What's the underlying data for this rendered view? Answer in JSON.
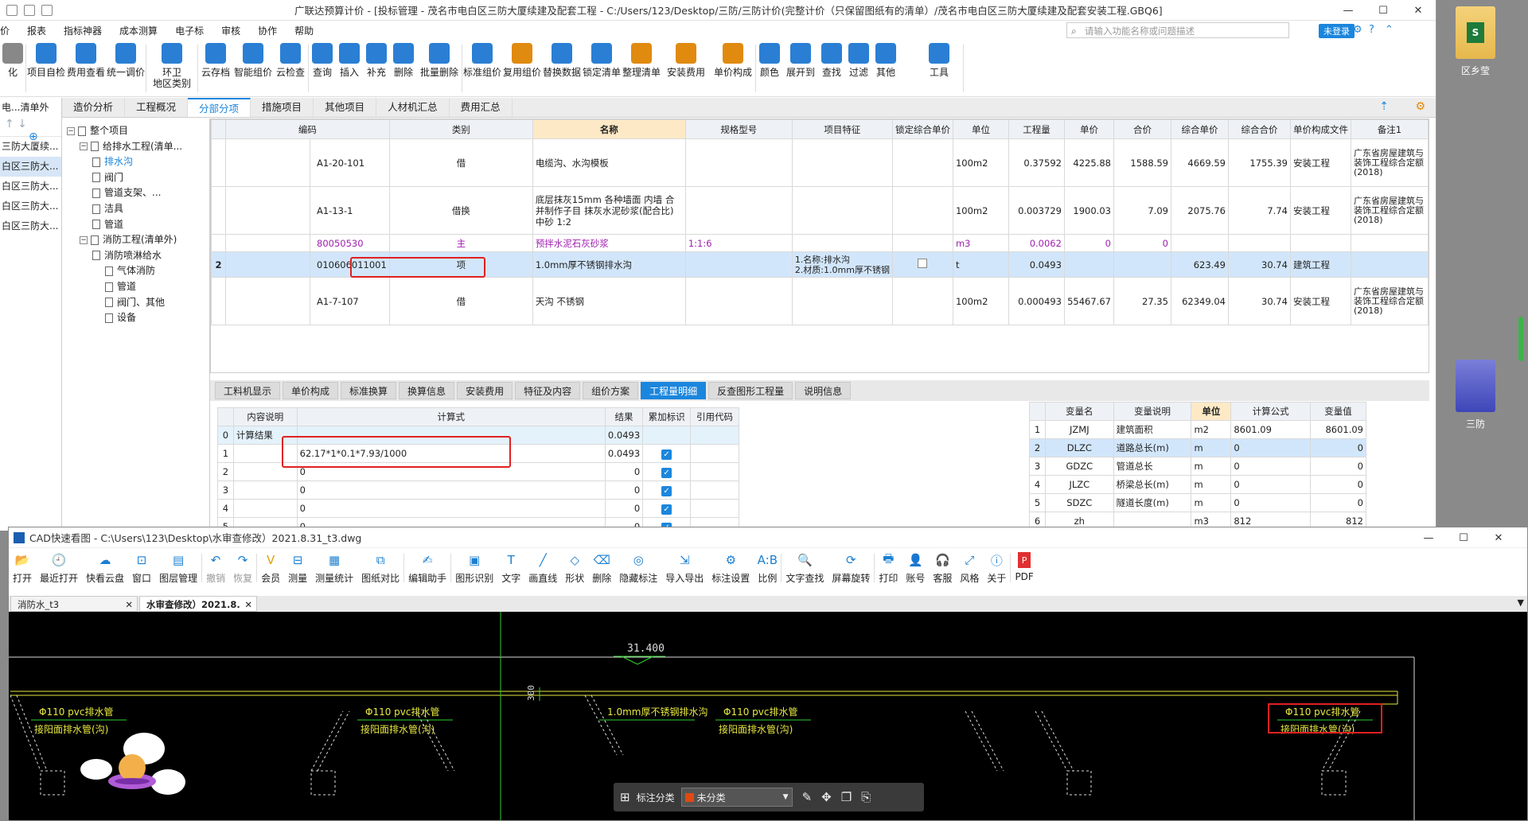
{
  "gld": {
    "title": "广联达预算计价 - [投标管理 - 茂名市电白区三防大厦续建及配套工程 - C:/Users/123/Desktop/三防/三防计价(完整计价（只保留图纸有的清单）/茂名市电白区三防大厦续建及配套安装工程.GBQ6]",
    "menu": [
      "价",
      "报表",
      "指标神器",
      "成本测算",
      "电子标",
      "审核",
      "协作",
      "帮助"
    ],
    "search_placeholder": "请输入功能名称或问题描述",
    "login": "未登录",
    "ribbon": [
      {
        "label": "化",
        "color": "#888888"
      },
      {
        "label": "项目自检",
        "color": "#2a7fd4"
      },
      {
        "label": "费用查看",
        "color": "#2a7fd4"
      },
      {
        "label": "统一调价",
        "color": "#2a7fd4"
      },
      {
        "label": "环卫\n地区类别",
        "color": "#2a7fd4"
      },
      {
        "label": "云存档",
        "color": "#2a7fd4"
      },
      {
        "label": "智能组价",
        "color": "#2a7fd4"
      },
      {
        "label": "云检查",
        "color": "#2a7fd4"
      },
      {
        "label": "查询",
        "color": "#2a7fd4"
      },
      {
        "label": "插入",
        "color": "#2a7fd4"
      },
      {
        "label": "补充",
        "color": "#2a7fd4"
      },
      {
        "label": "删除",
        "color": "#2a7fd4"
      },
      {
        "label": "批量删除",
        "color": "#2a7fd4"
      },
      {
        "label": "标准组价",
        "color": "#2a7fd4"
      },
      {
        "label": "复用组价",
        "color": "#e08a10"
      },
      {
        "label": "替换数据",
        "color": "#2a7fd4"
      },
      {
        "label": "锁定清单",
        "color": "#2a7fd4"
      },
      {
        "label": "整理清单",
        "color": "#e08a10"
      },
      {
        "label": "安装费用",
        "color": "#e08a10"
      },
      {
        "label": "单价构成",
        "color": "#e08a10"
      },
      {
        "label": "颜色",
        "color": "#2a7fd4"
      },
      {
        "label": "展开到",
        "color": "#2a7fd4"
      },
      {
        "label": "查找",
        "color": "#2a7fd4"
      },
      {
        "label": "过滤",
        "color": "#2a7fd4"
      },
      {
        "label": "其他",
        "color": "#2a7fd4"
      },
      {
        "label": "工具",
        "color": "#2a7fd4"
      }
    ],
    "left_strip": [
      "电...清单外",
      "三防大厦续...",
      "白区三防大...",
      "白区三防大...",
      "白区三防大...",
      "白区三防大..."
    ],
    "tabs": [
      "造价分析",
      "工程概况",
      "分部分项",
      "措施项目",
      "其他项目",
      "人材机汇总",
      "费用汇总"
    ],
    "active_tab": "分部分项",
    "tree": [
      {
        "label": "整个项目",
        "level": 0
      },
      {
        "label": "给排水工程(清单...",
        "level": 1
      },
      {
        "label": "排水沟",
        "level": 2,
        "selected": true
      },
      {
        "label": "阀门",
        "level": 2
      },
      {
        "label": "管道支架、...",
        "level": 2
      },
      {
        "label": "洁具",
        "level": 2
      },
      {
        "label": "管道",
        "level": 2
      },
      {
        "label": "消防工程(清单外)",
        "level": 1
      },
      {
        "label": "消防喷淋给水",
        "level": 2
      },
      {
        "label": "气体消防",
        "level": 3
      },
      {
        "label": "管道",
        "level": 3
      },
      {
        "label": "阀门、其他",
        "level": 3
      },
      {
        "label": "设备",
        "level": 3
      }
    ],
    "grid": {
      "headers": [
        "编码",
        "类别",
        "名称",
        "规格型号",
        "项目特征",
        "锁定综合单价",
        "单位",
        "工程量",
        "单价",
        "合价",
        "综合单价",
        "综合合价",
        "单价构成文件",
        "备注1"
      ],
      "rows": [
        {
          "no": "",
          "code": "A1-20-101",
          "cat": "借",
          "name": "电缆沟、水沟模板",
          "spec": "",
          "feature": "",
          "unit": "100m2",
          "qty": "0.37592",
          "price": "4225.88",
          "total": "1588.59",
          "cprice": "4669.59",
          "ctotal": "1755.39",
          "file": "安装工程",
          "note": "广东省房屋建筑与装饰工程综合定额(2018)",
          "type": "sub"
        },
        {
          "no": "",
          "code": "A1-13-1",
          "cat": "借换",
          "name": "底层抹灰15mm 各种墙面 内墙  合并制作子目 抹灰水泥砂浆(配合比) 中砂 1:2",
          "spec": "",
          "feature": "",
          "unit": "100m2",
          "qty": "0.003729",
          "price": "1900.03",
          "total": "7.09",
          "cprice": "2075.76",
          "ctotal": "7.74",
          "file": "安装工程",
          "note": "广东省房屋建筑与装饰工程综合定额(2018)",
          "type": "sub"
        },
        {
          "no": "",
          "code": "80050530",
          "cat": "主",
          "name": "预拌水泥石灰砂浆",
          "spec": "1:1:6",
          "feature": "",
          "unit": "m3",
          "qty": "0.0062",
          "price": "0",
          "total": "0",
          "cprice": "",
          "ctotal": "",
          "file": "",
          "note": "",
          "type": "main"
        },
        {
          "no": "2",
          "code": "010606011001",
          "cat": "项",
          "name": "1.0mm厚不锈钢排水沟",
          "spec": "",
          "feature": "1.名称:排水沟\n2.材质:1.0mm厚不锈钢",
          "unit": "t",
          "qty": "0.0493",
          "price": "",
          "total": "",
          "cprice": "623.49",
          "ctotal": "30.74",
          "file": "建筑工程",
          "note": "",
          "type": "sel"
        },
        {
          "no": "",
          "code": "A1-7-107",
          "cat": "借",
          "name": "天沟 不锈钢",
          "spec": "",
          "feature": "",
          "unit": "100m2",
          "qty": "0.000493",
          "price": "55467.67",
          "total": "27.35",
          "cprice": "62349.04",
          "ctotal": "30.74",
          "file": "安装工程",
          "note": "广东省房屋建筑与装饰工程综合定额(2018)",
          "type": "sub"
        }
      ]
    },
    "bottom_tabs": [
      "工料机显示",
      "单价构成",
      "标准换算",
      "换算信息",
      "安装费用",
      "特征及内容",
      "组价方案",
      "工程量明细",
      "反查图形工程量",
      "说明信息"
    ],
    "active_bottom_tab": "工程量明细",
    "calc": {
      "headers": [
        "内容说明",
        "计算式",
        "结果",
        "累加标识",
        "引用代码"
      ],
      "rows": [
        {
          "no": "0",
          "desc": "计算结果",
          "formula": "",
          "result": "0.0493",
          "check": false
        },
        {
          "no": "1",
          "desc": "",
          "formula": "62.17*1*0.1*7.93/1000",
          "result": "0.0493",
          "check": true
        },
        {
          "no": "2",
          "desc": "",
          "formula": "0",
          "result": "0",
          "check": true
        },
        {
          "no": "3",
          "desc": "",
          "formula": "0",
          "result": "0",
          "check": true
        },
        {
          "no": "4",
          "desc": "",
          "formula": "0",
          "result": "0",
          "check": true
        },
        {
          "no": "5",
          "desc": "",
          "formula": "0",
          "result": "0",
          "check": true
        }
      ]
    },
    "vars": {
      "headers": [
        "变量名",
        "变量说明",
        "单位",
        "计算公式",
        "变量值"
      ],
      "rows": [
        {
          "no": "1",
          "name": "JZMJ",
          "desc": "建筑面积",
          "unit": "m2",
          "formula": "8601.09",
          "value": "8601.09"
        },
        {
          "no": "2",
          "name": "DLZC",
          "desc": "道路总长(m)",
          "unit": "m",
          "formula": "0",
          "value": "0"
        },
        {
          "no": "3",
          "name": "GDZC",
          "desc": "管道总长",
          "unit": "m",
          "formula": "0",
          "value": "0"
        },
        {
          "no": "4",
          "name": "JLZC",
          "desc": "桥梁总长(m)",
          "unit": "m",
          "formula": "0",
          "value": "0"
        },
        {
          "no": "5",
          "name": "SDZC",
          "desc": "隧道长度(m)",
          "unit": "m",
          "formula": "0",
          "value": "0"
        },
        {
          "no": "6",
          "name": "zh",
          "desc": "",
          "unit": "m3",
          "formula": "812",
          "value": "812"
        }
      ]
    }
  },
  "desktop": {
    "icons": [
      {
        "label": "区乡莹"
      },
      {
        "label": "三防"
      }
    ]
  },
  "cad": {
    "title": "CAD快速看图 - C:\\Users\\123\\Desktop\\水审查修改）2021.8.31_t3.dwg",
    "toolbar": [
      "打开",
      "最近打开",
      "快看云盘",
      "窗口",
      "图层管理",
      "撤销",
      "恢复",
      "会员",
      "测量",
      "测量统计",
      "图纸对比",
      "编辑助手",
      "图形识别",
      "文字",
      "画直线",
      "形状",
      "删除",
      "隐藏标注",
      "导入导出",
      "标注设置",
      "比例",
      "文字查找",
      "屏幕旋转",
      "打印",
      "账号",
      "客服",
      "风格",
      "关于",
      "PDF"
    ],
    "tabs": [
      {
        "label": "消防水_t3",
        "active": false
      },
      {
        "label": "水审查修改）2021.8.",
        "active": true
      }
    ],
    "drawing": {
      "dim_top": "31.400",
      "dim_side": "300",
      "labels": [
        {
          "top": "Φ110 pvc排水管",
          "bottom": "接阳面排水管(沟)"
        },
        {
          "top": "Φ110 pvc排水管",
          "bottom": "接阳面排水管(沟)"
        },
        {
          "top": "1.0mm厚不锈钢排水沟",
          "bottom": ""
        },
        {
          "top": "Φ110 pvc排水管",
          "bottom": "接阳面排水管(沟)"
        },
        {
          "top": "Φ110 pvc排水管",
          "bottom": "接阳面排水管(沟)"
        }
      ]
    },
    "annot_bar": {
      "label": "标注分类",
      "category": "未分类"
    }
  }
}
